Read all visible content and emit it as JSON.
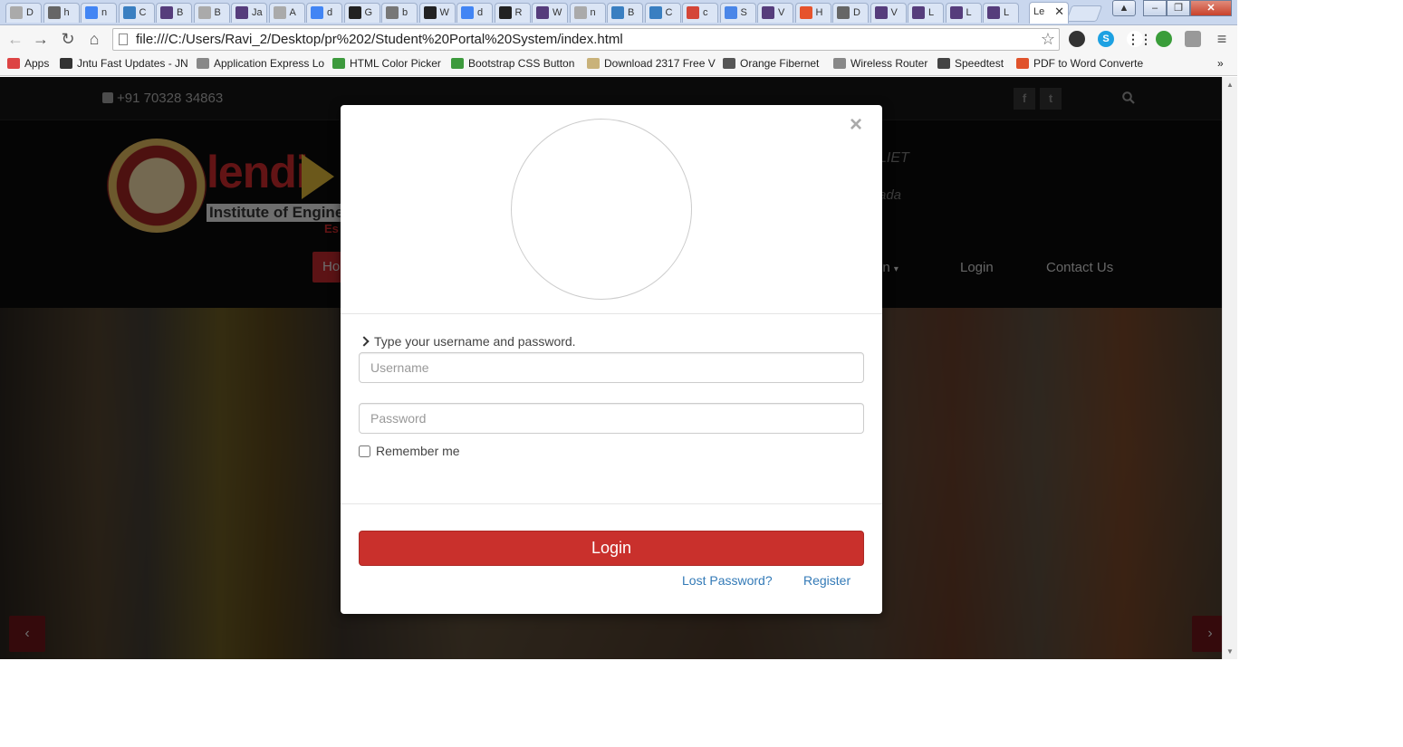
{
  "browser": {
    "tabs": [
      {
        "icon": "page-icon",
        "label": "D"
      },
      {
        "icon": "moon-icon",
        "label": "h"
      },
      {
        "icon": "google-icon",
        "label": "n"
      },
      {
        "icon": "bootstrap-icon",
        "label": "C"
      },
      {
        "icon": "b-icon",
        "label": "B"
      },
      {
        "icon": "page-icon",
        "label": "B"
      },
      {
        "icon": "b-icon",
        "label": "Ja"
      },
      {
        "icon": "page-icon",
        "label": "A"
      },
      {
        "icon": "google-icon",
        "label": "d"
      },
      {
        "icon": "github-icon",
        "label": "G"
      },
      {
        "icon": "c-icon",
        "label": "b"
      },
      {
        "icon": "github-icon",
        "label": "W"
      },
      {
        "icon": "google-icon",
        "label": "d"
      },
      {
        "icon": "github-icon",
        "label": "R"
      },
      {
        "icon": "b-icon",
        "label": "W"
      },
      {
        "icon": "page-icon",
        "label": "n"
      },
      {
        "icon": "bootstrap-icon",
        "label": "B"
      },
      {
        "icon": "bootstrap-icon",
        "label": "C"
      },
      {
        "icon": "gmail-icon",
        "label": "c"
      },
      {
        "icon": "docs-icon",
        "label": "S"
      },
      {
        "icon": "b-icon",
        "label": "V"
      },
      {
        "icon": "joomla-icon",
        "label": "H"
      },
      {
        "icon": "download-icon",
        "label": "D"
      },
      {
        "icon": "b-icon",
        "label": "V"
      },
      {
        "icon": "b-icon",
        "label": "L"
      },
      {
        "icon": "b-icon",
        "label": "L"
      },
      {
        "icon": "b-icon",
        "label": "L"
      }
    ],
    "active_tab": {
      "label": "Le",
      "close": "✕"
    },
    "window_buttons": {
      "minimize": "–",
      "maximize": "❐",
      "close": "✕"
    },
    "url": "file:///C:/Users/Ravi_2/Desktop/pr%202/Student%20Portal%20System/index.html",
    "nav": {
      "back": "←",
      "forward": "→",
      "reload": "↻",
      "home": "⌂",
      "star": "☆",
      "menu": "≡"
    },
    "bookmarks": [
      {
        "icon": "apps-icon",
        "label": "Apps"
      },
      {
        "icon": "grad-cap-icon",
        "label": "Jntu Fast Updates - JN"
      },
      {
        "icon": "page-icon",
        "label": "Application Express Lo"
      },
      {
        "icon": "w3-icon",
        "label": "HTML Color Picker"
      },
      {
        "icon": "w3-icon",
        "label": "Bootstrap CSS Button"
      },
      {
        "icon": "folder-icon",
        "label": "Download 2317 Free V"
      },
      {
        "icon": "moon-icon",
        "label": "Orange Fibernet"
      },
      {
        "icon": "page-icon",
        "label": "Wireless Router"
      },
      {
        "icon": "speed-icon",
        "label": "Speedtest"
      },
      {
        "icon": "pdf-icon",
        "label": "PDF to Word Converte"
      }
    ],
    "bookmarks_overflow": "»"
  },
  "site": {
    "phone": "+91 70328 34863",
    "social": [
      "f",
      "t"
    ],
    "logo_text": "lendi",
    "logo_sub": "Institute of Engineering",
    "logo_sub2": "Es",
    "tagline1": "LIET",
    "tagline2": "ada",
    "nav": {
      "home": "Ho",
      "partial": "on",
      "login": "Login",
      "contact": "Contact Us"
    },
    "slider": {
      "prev": "‹",
      "next": "›"
    }
  },
  "modal": {
    "close": "×",
    "instruction": "Type your username and password.",
    "username_placeholder": "Username",
    "password_placeholder": "Password",
    "remember": "Remember me",
    "login_button": "Login",
    "lost_password": "Lost Password?",
    "register": "Register"
  },
  "colors": {
    "accent": "#c9302c",
    "link": "#337ab7"
  }
}
